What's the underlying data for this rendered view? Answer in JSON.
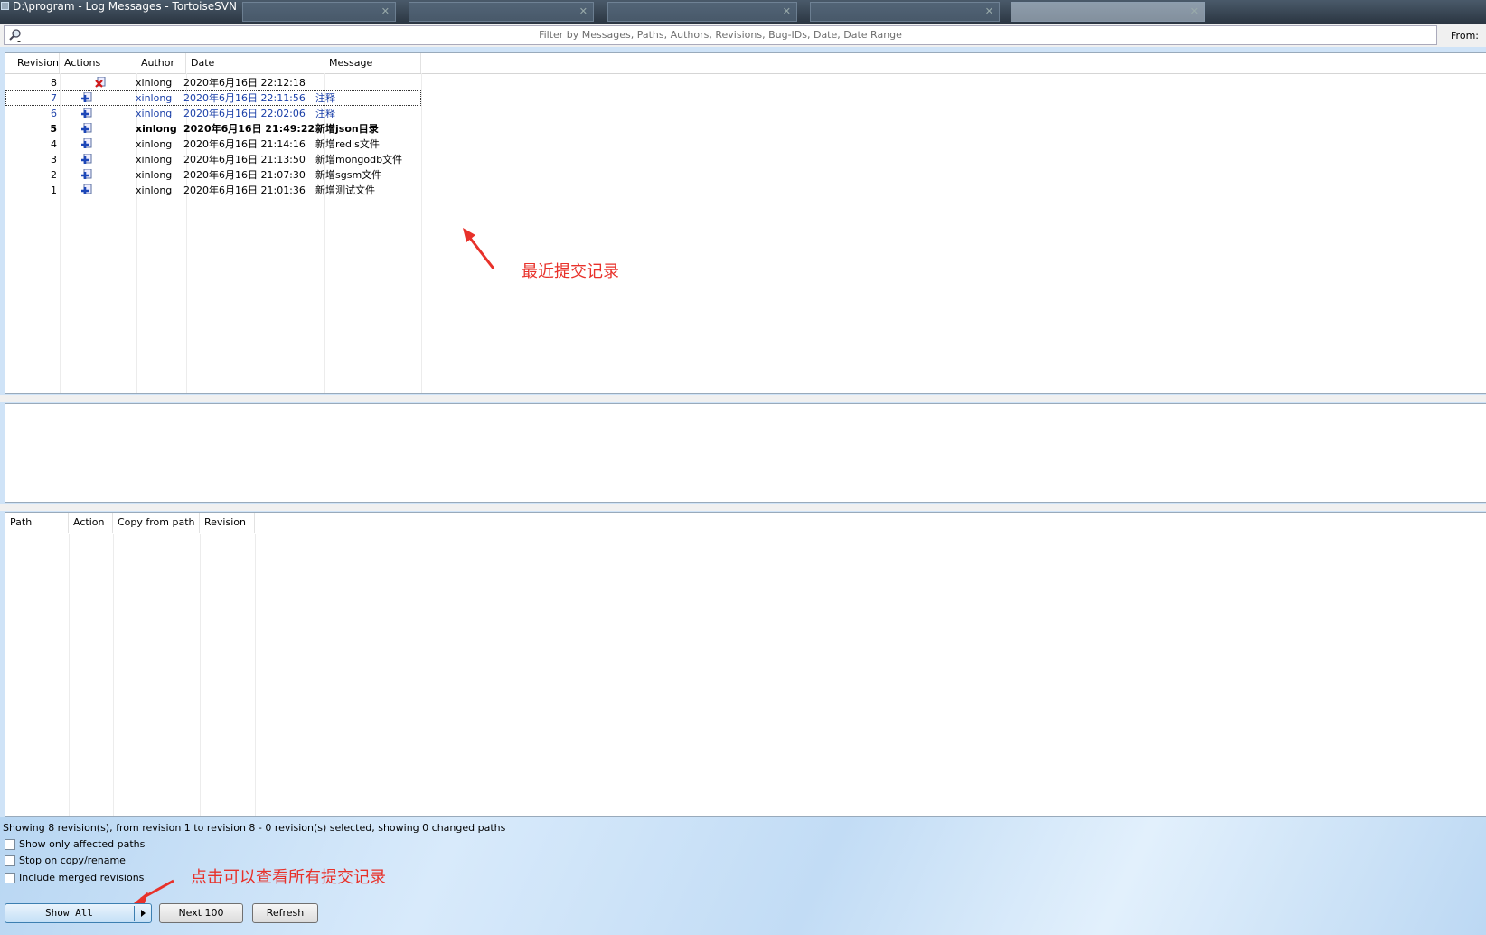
{
  "window": {
    "title": "D:\\program - Log Messages - TortoiseSVN"
  },
  "filter": {
    "placeholder": "Filter by Messages, Paths, Authors, Revisions, Bug-IDs, Date, Date Range",
    "from_label": "From:"
  },
  "log_list": {
    "columns": [
      "Revision",
      "Actions",
      "Author",
      "Date",
      "Message"
    ],
    "rows": [
      {
        "revision": "8",
        "action": "delete-icon",
        "author": "xinlong",
        "date": "2020年6月16日 22:12:18",
        "message": "",
        "style": "normal"
      },
      {
        "revision": "7",
        "action": "add-icon",
        "author": "xinlong",
        "date": "2020年6月16日 22:11:56",
        "message": "注释",
        "style": "blue"
      },
      {
        "revision": "6",
        "action": "add-icon",
        "author": "xinlong",
        "date": "2020年6月16日 22:02:06",
        "message": "注释",
        "style": "blue"
      },
      {
        "revision": "5",
        "action": "add-icon",
        "author": "xinlong",
        "date": "2020年6月16日 21:49:22",
        "message": "新增json目录",
        "style": "bold"
      },
      {
        "revision": "4",
        "action": "add-icon",
        "author": "xinlong",
        "date": "2020年6月16日 21:14:16",
        "message": "新增redis文件",
        "style": "normal"
      },
      {
        "revision": "3",
        "action": "add-icon",
        "author": "xinlong",
        "date": "2020年6月16日 21:13:50",
        "message": "新增mongodb文件",
        "style": "normal"
      },
      {
        "revision": "2",
        "action": "add-icon",
        "author": "xinlong",
        "date": "2020年6月16日 21:07:30",
        "message": "新增sgsm文件",
        "style": "normal"
      },
      {
        "revision": "1",
        "action": "add-icon",
        "author": "xinlong",
        "date": "2020年6月16日 21:01:36",
        "message": "新增测试文件",
        "style": "normal"
      }
    ]
  },
  "paths_list": {
    "columns": [
      "Path",
      "Action",
      "Copy from path",
      "Revision"
    ]
  },
  "status": {
    "text": "Showing 8 revision(s), from revision 1 to revision 8 - 0 revision(s) selected, showing 0 changed paths"
  },
  "options": {
    "show_only_affected": "Show only affected paths",
    "stop_on_copy": "Stop on copy/rename",
    "include_merged": "Include merged revisions"
  },
  "buttons": {
    "show_all": "Show All",
    "next_100": "Next 100",
    "refresh": "Refresh"
  },
  "annotations": {
    "recent_commits": "最近提交记录",
    "show_all_hint": "点击可以查看所有提交记录"
  },
  "colors": {
    "annotation": "#e8312a",
    "selected_text": "#1a3fa8"
  }
}
